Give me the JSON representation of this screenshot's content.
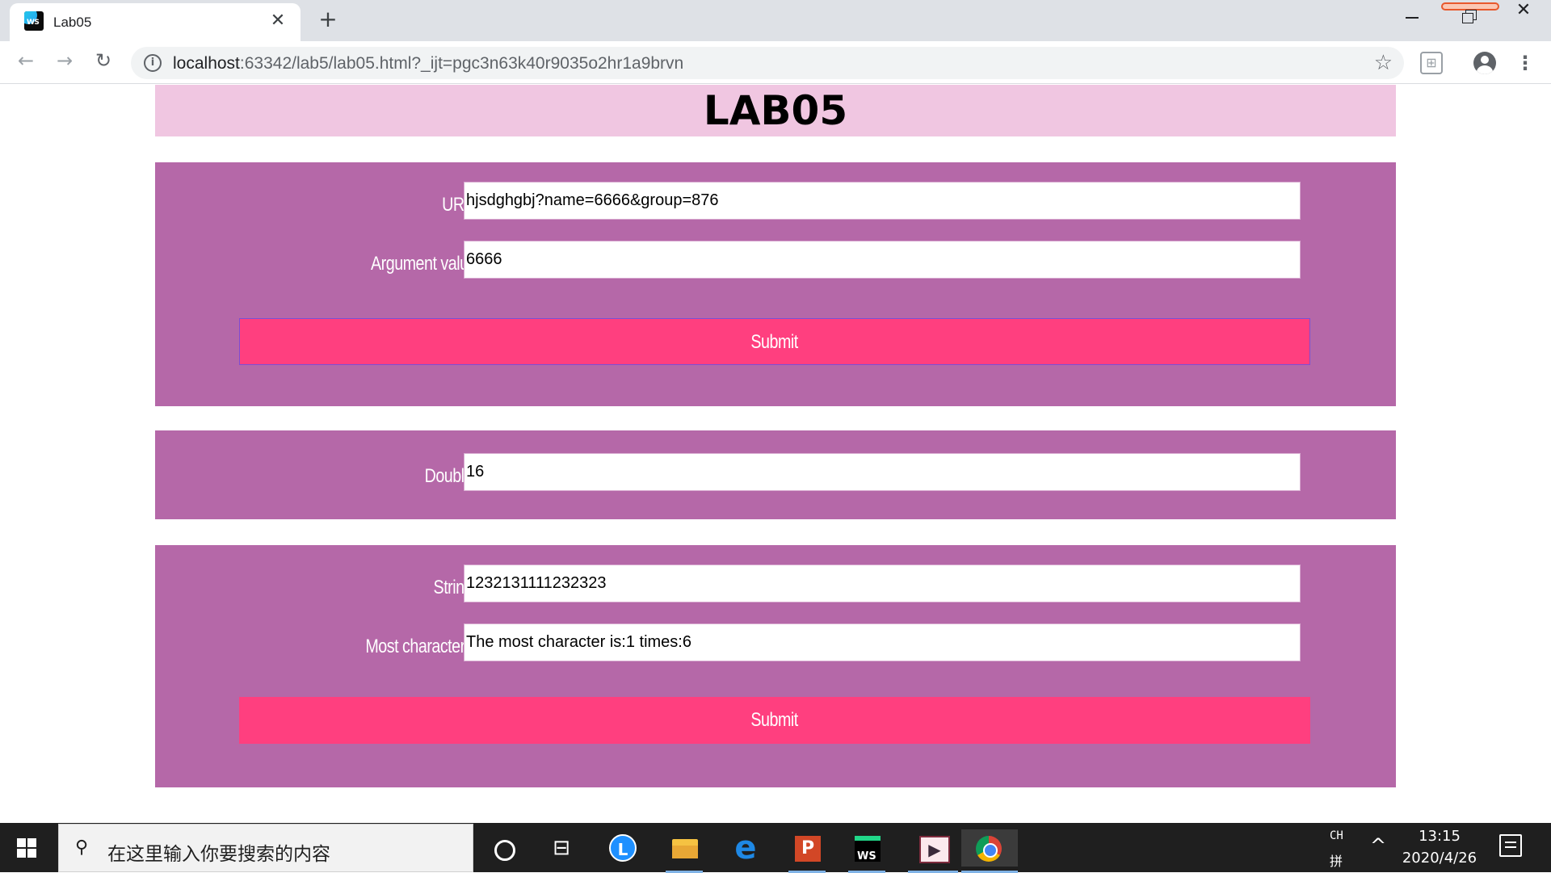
{
  "browser": {
    "tab": {
      "favicon_text": "WS",
      "title": "Lab05",
      "close": "✕"
    },
    "new_tab": "+",
    "window_controls": {
      "minimize": "",
      "maximize": "",
      "close": "✕"
    },
    "nav": {
      "back": "←",
      "forward": "→",
      "reload": "↻"
    },
    "address": {
      "info": "i",
      "host": "localhost",
      "path": ":63342/lab5/lab05.html?_ijt=pgc3n63k40r9035o2hr1a9brvn",
      "bookmark": "☆"
    },
    "extension_icon": "ext-icon",
    "menu": "⋮"
  },
  "page": {
    "title": "LAB05",
    "url_form": {
      "url_label": "URL:",
      "url_value": "hjsdghgbj?name=6666&group=876",
      "arg_label": "Argument value",
      "arg_value": "6666",
      "submit_label": "Submit"
    },
    "double_form": {
      "label": "Double:",
      "value": "16"
    },
    "string_form": {
      "string_label": "String:",
      "string_value": "1232131111232323",
      "most_label": "Most characters:",
      "most_value": "The most character is:1 times:6",
      "submit_label": "Submit"
    }
  },
  "colors": {
    "header_bg": "#f0c6e1",
    "panel_bg": "#b568a8",
    "button_bg": "#ff3f7f"
  },
  "taskbar": {
    "search_placeholder": "在这里输入你要搜索的内容",
    "task_view_glyph": "⊟",
    "edge_glyph": "e",
    "tray": {
      "lang": "CH",
      "ime": "拼",
      "chevron": "^",
      "time": "13:15",
      "date": "2020/4/26"
    }
  }
}
